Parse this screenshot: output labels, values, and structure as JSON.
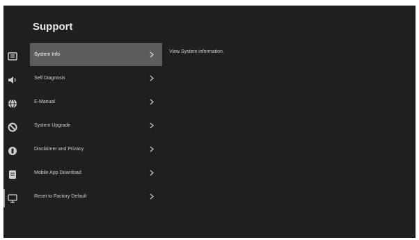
{
  "page": {
    "title": "Support",
    "description": "View System information."
  },
  "menu": {
    "items": [
      {
        "label": "System Info",
        "icon": "info-card-icon",
        "selected": true
      },
      {
        "label": "Self Diagnosis",
        "icon": "speaker-sound-icon",
        "selected": false
      },
      {
        "label": "E-Manual",
        "icon": "globe-icon",
        "selected": false
      },
      {
        "label": "System Upgrade",
        "icon": "blocked-circle-icon",
        "selected": false
      },
      {
        "label": "Disclaimer and Privacy",
        "icon": "shield-badge-icon",
        "selected": false
      },
      {
        "label": "Mobile App Download",
        "icon": "phone-app-icon",
        "selected": false
      },
      {
        "label": "Reset to Factory Default",
        "icon": "monitor-icon",
        "selected": false
      }
    ]
  },
  "colors": {
    "background": "#1f1f1f",
    "selected_row": "#5d5d5d",
    "text": "#cfcfcf",
    "title": "#e8e8e8"
  }
}
